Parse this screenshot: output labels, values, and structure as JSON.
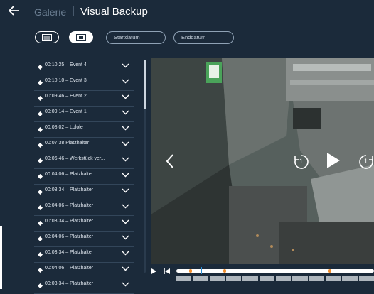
{
  "header": {
    "back_icon": "arrow-left-icon",
    "breadcrumb": "Galerie",
    "separator": "|",
    "title": "Visual Backup"
  },
  "toolbar": {
    "list_view_icon": "list-view-icon",
    "video_view_icon": "video-view-icon",
    "start_date_placeholder": "Startdatum",
    "end_date_placeholder": "Enddatum"
  },
  "events": [
    {
      "label": "00:10:25 – Event 4"
    },
    {
      "label": "00:10:10 – Event 3"
    },
    {
      "label": "00:09:46 – Event 2"
    },
    {
      "label": "00:09:14 – Event 1"
    },
    {
      "label": "00:08:02 – Lolole"
    },
    {
      "label": "00:07:38 Platzhalter"
    },
    {
      "label": "00:06:46 – Werkstück ver..."
    },
    {
      "label": "00:04:06 – Platzhalter"
    },
    {
      "label": "00:03:34 – Platzhalter"
    },
    {
      "label": "00:04:06 – Platzhalter"
    },
    {
      "label": "00:03:34 – Platzhalter"
    },
    {
      "label": "00:04:06 – Platzhalter"
    },
    {
      "label": "00:03:34 – Platzhalter"
    },
    {
      "label": "00:04:06 – Platzhalter"
    },
    {
      "label": "00:03:34 – Platzhalter"
    }
  ],
  "player": {
    "prev_icon": "chevron-left-icon",
    "rewind_icon": "rewind-1-icon",
    "rewind_label": "1",
    "play_icon": "play-icon",
    "forward_icon": "forward-1-icon",
    "forward_label": "1",
    "timeline_play_icon": "play-icon",
    "skip_start_icon": "skip-to-start-icon"
  },
  "colors": {
    "background": "#1b2a3a",
    "accent_marker": "#f08c2a",
    "playhead": "#2b8ccf"
  }
}
